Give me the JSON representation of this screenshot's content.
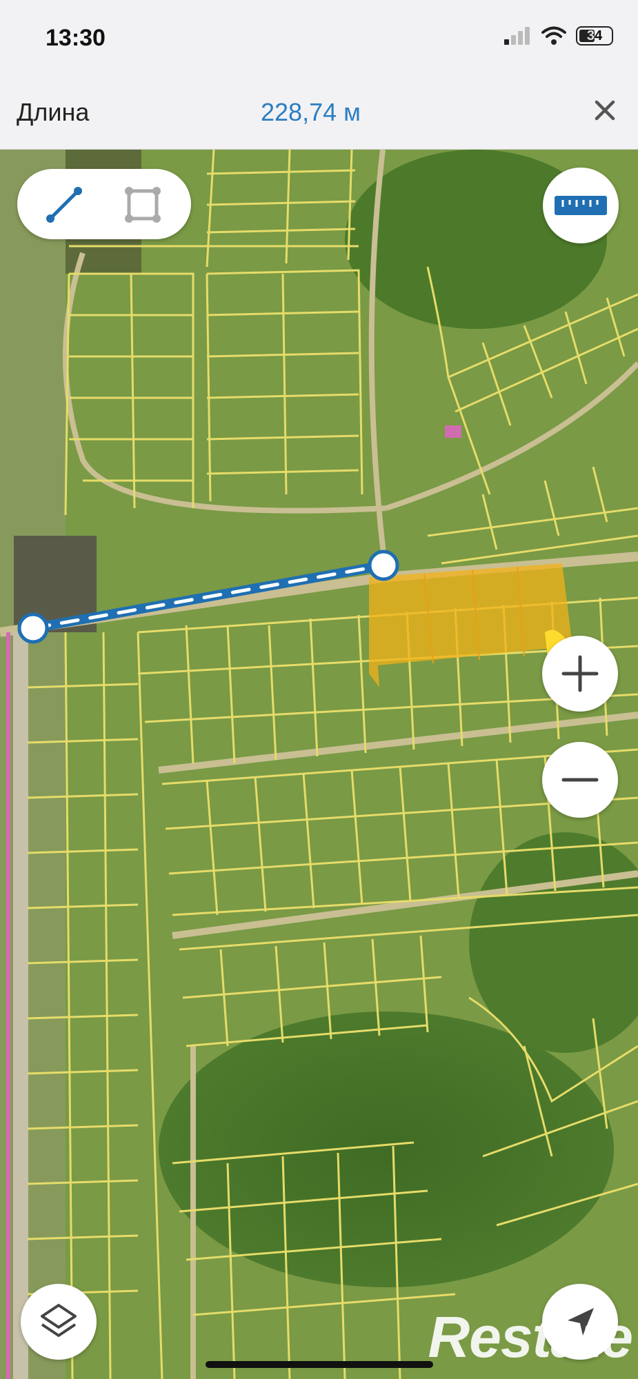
{
  "status_bar": {
    "time": "13:30",
    "battery": "34"
  },
  "header": {
    "label": "Длина",
    "value": "228,74 м"
  },
  "measure": {
    "mode_line": "line-icon",
    "mode_area": "polygon-icon"
  },
  "controls": {
    "ruler": "ruler-icon",
    "zoom_in": "plus-icon",
    "zoom_out": "minus-icon",
    "layers": "layers-icon",
    "locate": "location-arrow-icon"
  },
  "colors": {
    "accent": "#2a7ec2",
    "parcel_line": "#e6dc6a",
    "highlight": "#f2b21a"
  },
  "watermark": "Restate"
}
